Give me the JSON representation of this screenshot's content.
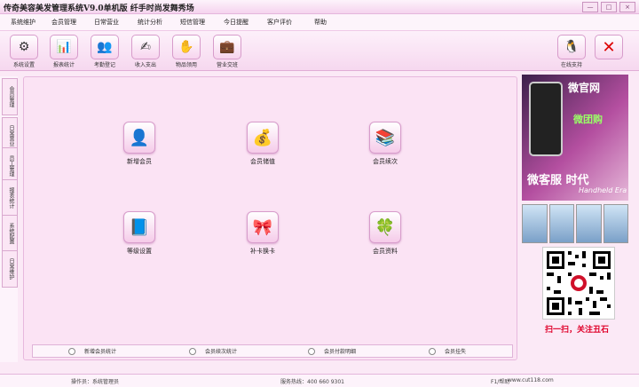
{
  "window": {
    "title": "传奇美容美发管理系统V9.0单机版  纤手时尚发舞秀场",
    "buttons": [
      "—",
      "□",
      "×"
    ]
  },
  "menu": [
    "系统维护",
    "会员管理",
    "日常营业",
    "统计分析",
    "短信管理",
    "今日提醒",
    "客户评价",
    "帮助"
  ],
  "toolbar": {
    "left": [
      {
        "label": "系统设置",
        "icon": "gear-icon"
      },
      {
        "label": "报表统计",
        "icon": "report-icon"
      },
      {
        "label": "考勤登记",
        "icon": "attendance-icon"
      },
      {
        "label": "收入支出",
        "icon": "income-icon"
      },
      {
        "label": "物品领用",
        "icon": "goods-icon"
      },
      {
        "label": "营业交班",
        "icon": "shift-icon"
      }
    ],
    "right": [
      {
        "label": "在线支持",
        "icon": "qq-penguin-icon"
      },
      {
        "label": "",
        "icon": "exit-x-icon"
      }
    ]
  },
  "sidebar": [
    "会员管理",
    "日常营业",
    "员工管理",
    "报表统计",
    "系统配置",
    "日常维护"
  ],
  "modules": [
    {
      "label": "新增会员",
      "icon": "member-add-icon",
      "glyph": "👤"
    },
    {
      "label": "会员储值",
      "icon": "coins-icon",
      "glyph": "💰"
    },
    {
      "label": "会员续次",
      "icon": "books-icon",
      "glyph": "📚"
    },
    {
      "label": "等级设置",
      "icon": "level-book-icon",
      "glyph": "📘"
    },
    {
      "label": "补卡换卡",
      "icon": "card-swap-icon",
      "glyph": "🎀"
    },
    {
      "label": "会员资料",
      "icon": "member-data-icon",
      "glyph": "🍀"
    }
  ],
  "radios": [
    "新增会员统计",
    "会员续次统计",
    "会员付款明细",
    "会员挂失"
  ],
  "ad": {
    "line1": "微官网",
    "line2": "微团购",
    "line3": "微客服 时代",
    "line4": "Handheld Era"
  },
  "qr_caption": "扫一扫，关注丑石",
  "status": {
    "operator": "操作员：系统管理员",
    "hotline": "服务热线：400 660 9301",
    "help": "F1/帮助",
    "site": "www.cut118.com"
  }
}
